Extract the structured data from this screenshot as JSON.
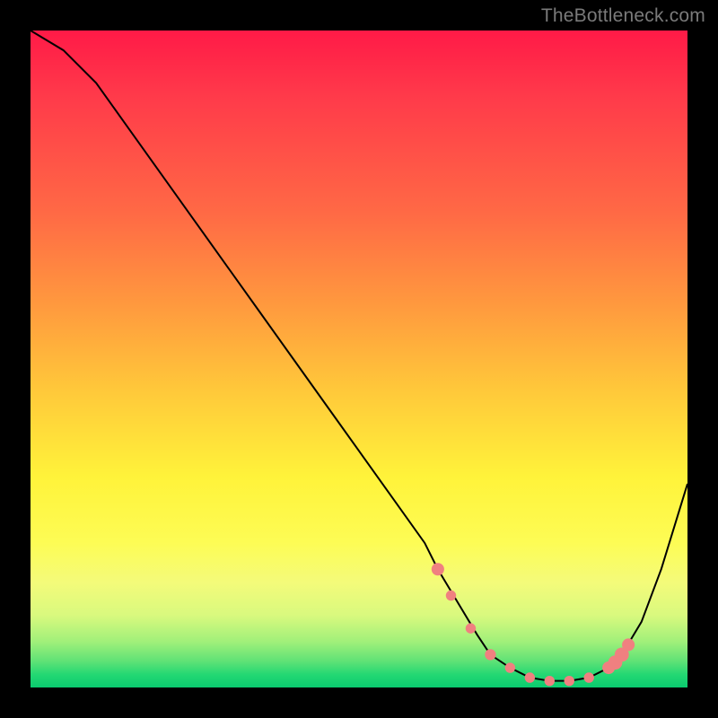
{
  "watermark": {
    "text": "TheBottleneck.com"
  },
  "colors": {
    "curve": "#000000",
    "marker_fill": "#f08080",
    "marker_stroke": "#d46a6a",
    "background_black": "#000000"
  },
  "chart_data": {
    "type": "line",
    "title": "",
    "xlabel": "",
    "ylabel": "",
    "xlim": [
      0,
      100
    ],
    "ylim": [
      0,
      100
    ],
    "grid": false,
    "legend": false,
    "series": [
      {
        "name": "bottleneck-curve",
        "x": [
          0,
          5,
          10,
          15,
          20,
          25,
          30,
          35,
          40,
          45,
          50,
          55,
          60,
          62,
          65,
          68,
          70,
          73,
          76,
          79,
          82,
          85,
          88,
          90,
          93,
          96,
          100
        ],
        "values": [
          100,
          97,
          92,
          85,
          78,
          71,
          64,
          57,
          50,
          43,
          36,
          29,
          22,
          18,
          13,
          8,
          5,
          3,
          1.5,
          1,
          1,
          1.5,
          3,
          5,
          10,
          18,
          31
        ]
      }
    ],
    "markers": {
      "name": "highlighted-segment",
      "x": [
        62,
        64,
        67,
        70,
        73,
        76,
        79,
        82,
        85,
        88,
        89,
        90,
        91
      ],
      "values": [
        18,
        14,
        9,
        5,
        3,
        1.5,
        1,
        1,
        1.5,
        3,
        3.8,
        5,
        6.5
      ],
      "size": [
        3.2,
        2.6,
        2.6,
        2.8,
        2.6,
        2.6,
        2.6,
        2.6,
        2.6,
        3.2,
        3.6,
        3.6,
        3.2
      ]
    }
  }
}
